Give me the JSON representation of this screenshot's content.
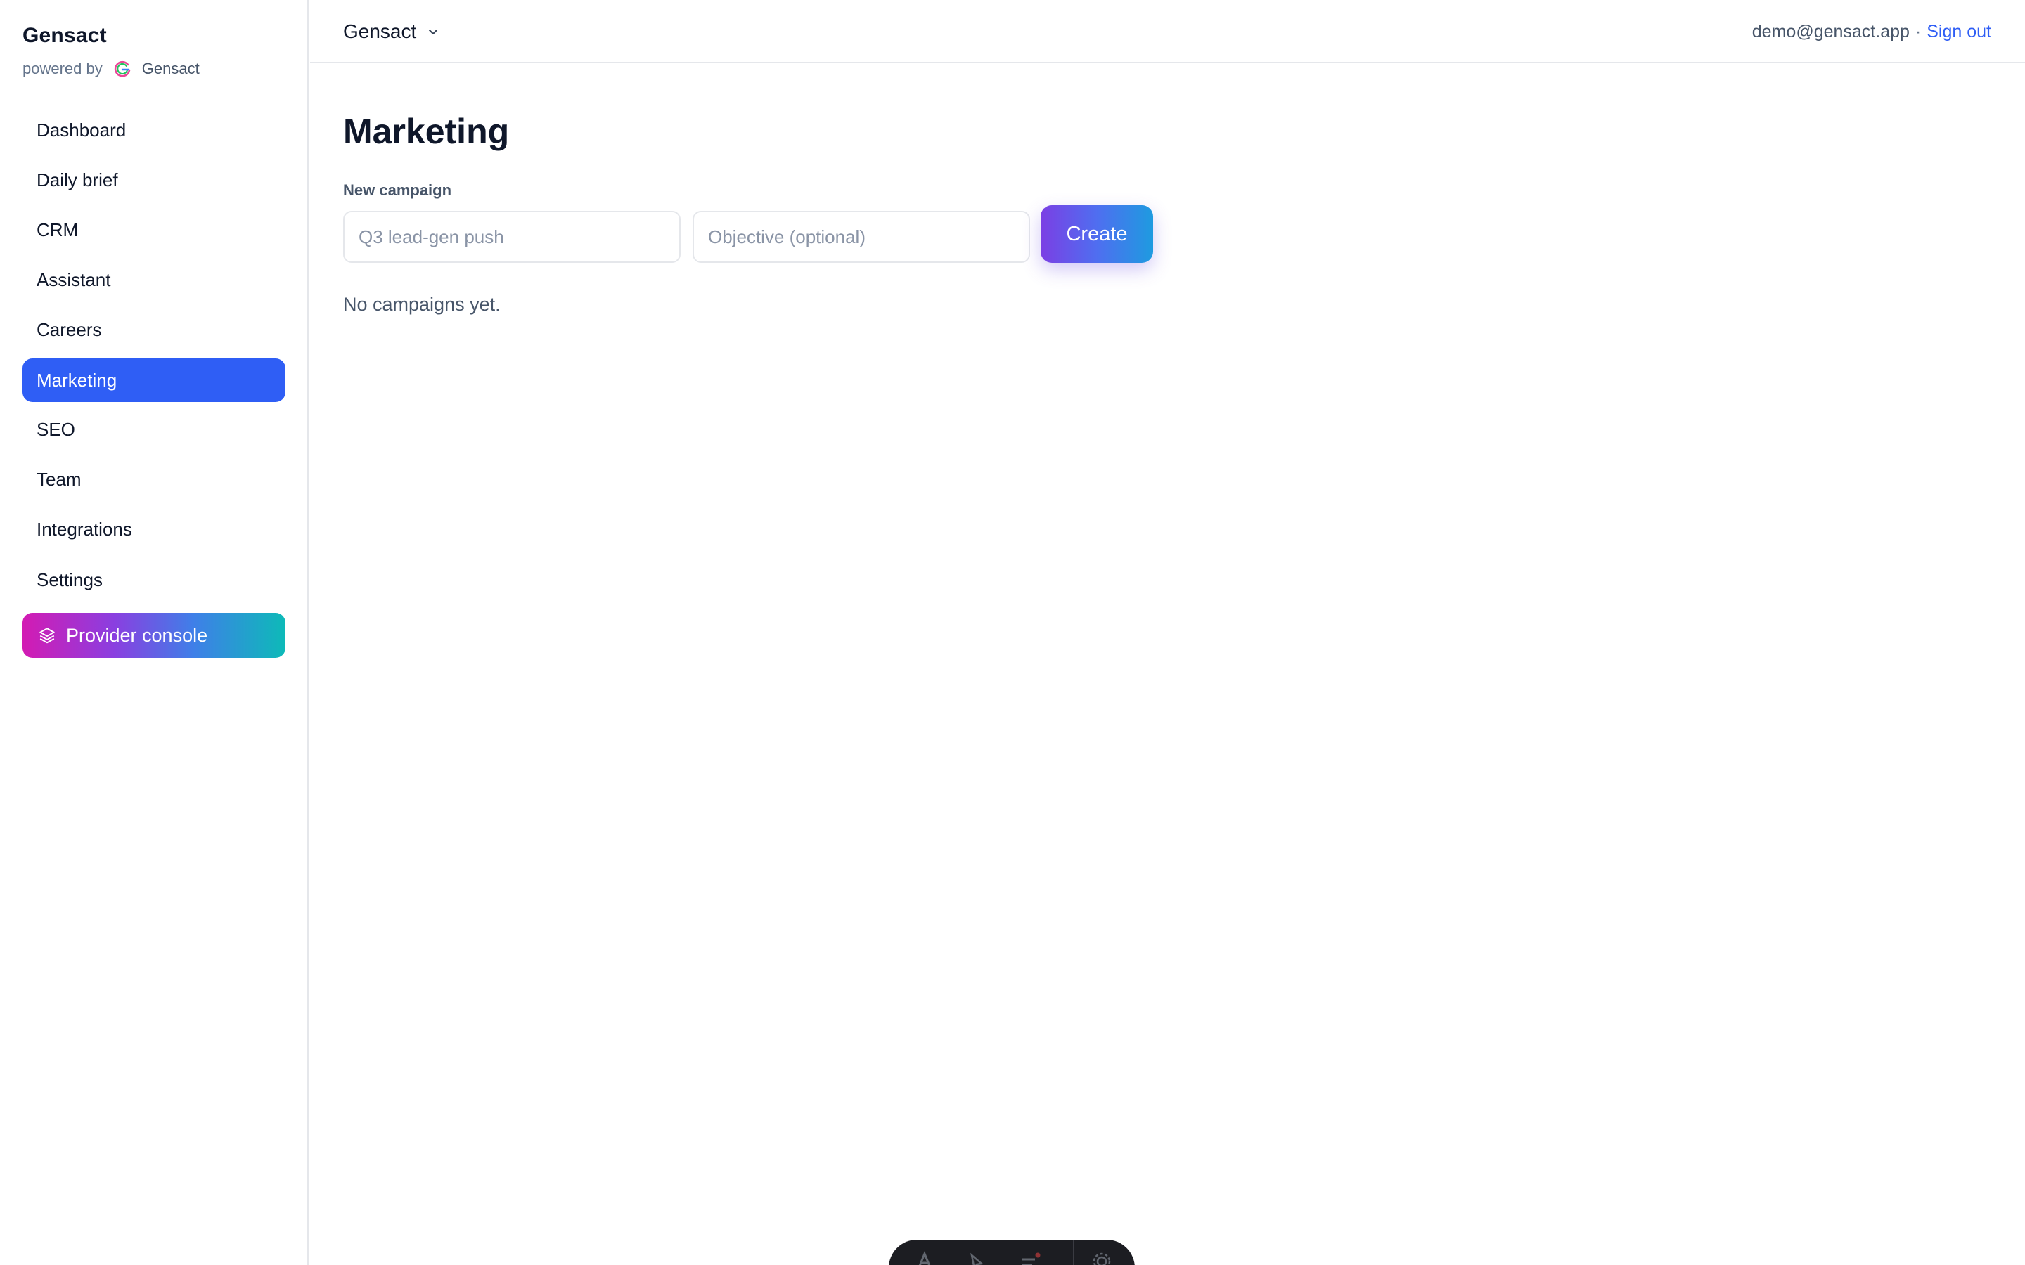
{
  "sidebar": {
    "brand_title": "Gensact",
    "powered_by_label": "powered by",
    "powered_by_brand": "Gensact",
    "items": [
      {
        "label": "Dashboard",
        "active": false
      },
      {
        "label": "Daily brief",
        "active": false
      },
      {
        "label": "CRM",
        "active": false
      },
      {
        "label": "Assistant",
        "active": false
      },
      {
        "label": "Careers",
        "active": false
      },
      {
        "label": "Marketing",
        "active": true
      },
      {
        "label": "SEO",
        "active": false
      },
      {
        "label": "Team",
        "active": false
      },
      {
        "label": "Integrations",
        "active": false
      },
      {
        "label": "Settings",
        "active": false
      }
    ],
    "provider_console_label": "Provider console"
  },
  "topbar": {
    "workspace_name": "Gensact",
    "user_email": "demo@gensact.app",
    "separator": "·",
    "sign_out_label": "Sign out"
  },
  "main": {
    "title": "Marketing",
    "new_campaign_label": "New campaign",
    "name_input": {
      "value": "",
      "placeholder": "Q3 lead-gen push"
    },
    "objective_input": {
      "value": "",
      "placeholder": "Objective (optional)"
    },
    "create_label": "Create",
    "empty_state": "No campaigns yet."
  },
  "colors": {
    "accent": "#2f5ef5",
    "create_gradient": [
      "#7b3fe4",
      "#1e9be0"
    ],
    "provider_gradient": [
      "#d31bb3",
      "#0dbab8"
    ]
  }
}
